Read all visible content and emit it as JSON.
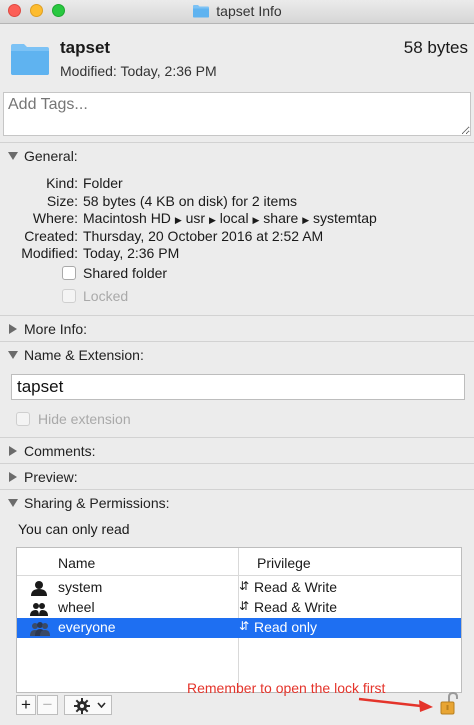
{
  "window": {
    "title": "tapset Info"
  },
  "header": {
    "name": "tapset",
    "size": "58 bytes",
    "modified": "Modified: Today, 2:36 PM"
  },
  "tags": {
    "placeholder": "Add Tags..."
  },
  "general": {
    "title": "General:",
    "kind_label": "Kind:",
    "kind": "Folder",
    "size_label": "Size:",
    "size": "58 bytes (4 KB on disk) for 2 items",
    "where_label": "Where:",
    "where_path": [
      "Macintosh HD",
      "usr",
      "local",
      "share",
      "systemtap"
    ],
    "created_label": "Created:",
    "created": "Thursday, 20 October 2016 at 2:52 AM",
    "modified_label": "Modified:",
    "modified": "Today, 2:36 PM",
    "shared_folder": "Shared folder",
    "locked": "Locked"
  },
  "more_info": {
    "title": "More Info:"
  },
  "name_extension": {
    "title": "Name & Extension:",
    "value": "tapset",
    "hide_extension": "Hide extension"
  },
  "comments": {
    "title": "Comments:"
  },
  "preview": {
    "title": "Preview:"
  },
  "sharing": {
    "title": "Sharing & Permissions:",
    "status": "You can only read",
    "columns": {
      "name": "Name",
      "privilege": "Privilege"
    },
    "rows": [
      {
        "name": "system",
        "privilege": "Read & Write",
        "icon": "single-user-icon",
        "selected": false
      },
      {
        "name": "wheel",
        "privilege": "Read & Write",
        "icon": "group-icon",
        "selected": false
      },
      {
        "name": "everyone",
        "privilege": "Read only",
        "icon": "everyone-icon",
        "selected": true
      }
    ]
  },
  "toolbar": {
    "add": "+",
    "remove": "−"
  },
  "annotation": {
    "text": "Remember to open the lock first"
  },
  "colors": {
    "accent": "#1e6ff2",
    "annotation": "#e4342b",
    "folder": "#5fb3f0"
  }
}
